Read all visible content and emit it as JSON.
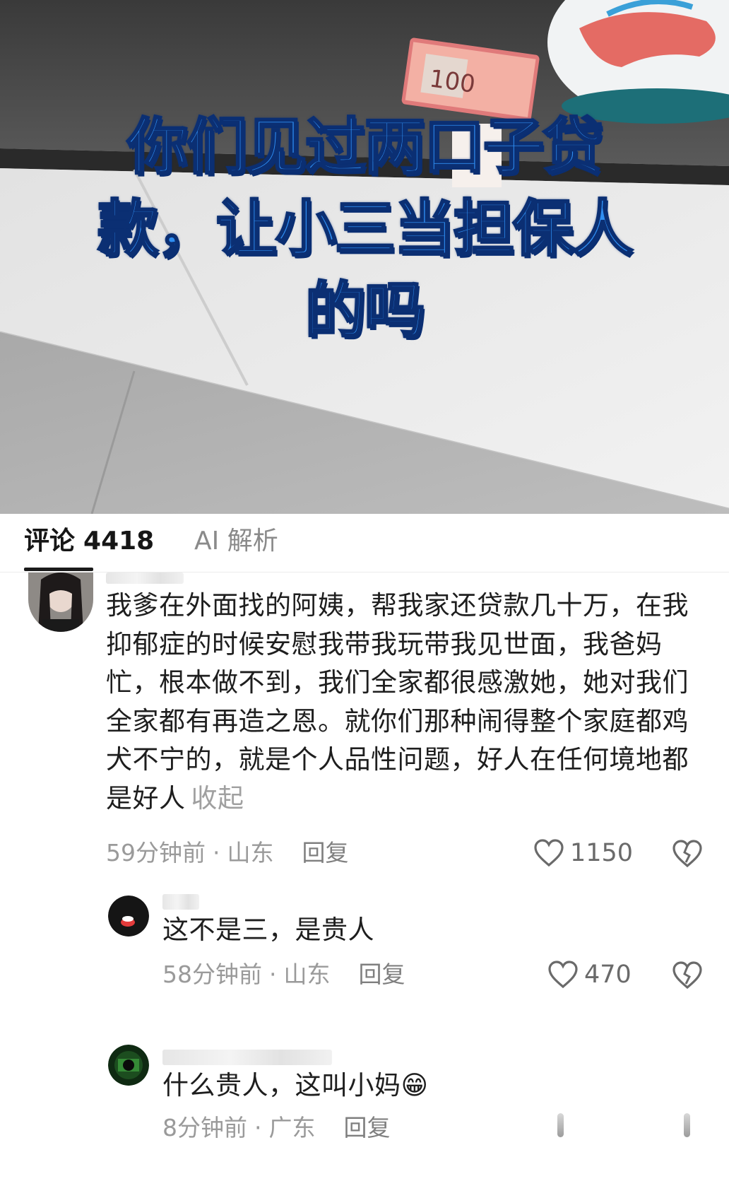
{
  "video": {
    "caption_lines": [
      "你们见过两口子贷",
      "款，让小三当担保人",
      "的吗"
    ]
  },
  "tabs": {
    "comments_label": "评论",
    "comments_count": "4418",
    "ai_label": "AI 解析"
  },
  "comments": [
    {
      "text": "我爹在外面找的阿姨，帮我家还贷款几十万，在我抑郁症的时候安慰我带我玩带我见世面，我爸妈忙，根本做不到，我们全家都很感激她，她对我们全家都有再造之恩。就你们那种闹得整个家庭都鸡犬不宁的，就是个人品性问题，好人在任何境地都是好人",
      "collapse_label": "收起",
      "time": "59分钟前",
      "location": "山东",
      "reply_label": "回复",
      "likes": "1150"
    },
    {
      "text": "这不是三，是贵人",
      "time": "58分钟前",
      "location": "山东",
      "reply_label": "回复",
      "likes": "470"
    },
    {
      "text": "什么贵人，这叫小妈😁",
      "time": "8分钟前",
      "location": "广东",
      "reply_label": "回复"
    }
  ],
  "icons": {
    "like": "heart-outline-icon",
    "dislike": "broken-heart-icon"
  },
  "colors": {
    "caption_fill": "#2f8ef2",
    "caption_stroke": "#0b2f73",
    "meta_text": "#9a9a9a"
  }
}
